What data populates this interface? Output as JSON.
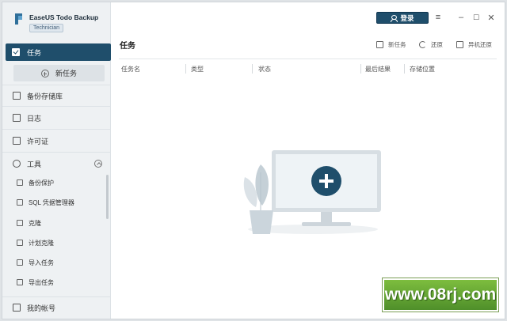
{
  "app": {
    "name": "EaseUS Todo Backup",
    "edition": "Technician"
  },
  "topbar": {
    "login_label": "登录",
    "menu_icon": "hamburger-icon",
    "minimize_icon": "minimize-icon",
    "maximize_icon": "maximize-icon",
    "close_icon": "close-icon"
  },
  "sidebar": {
    "active_item": "任务",
    "new_task": "新任务",
    "items": [
      {
        "label": "备份存储库",
        "icon": "storage-icon"
      },
      {
        "label": "日志",
        "icon": "log-icon"
      },
      {
        "label": "许可证",
        "icon": "license-icon"
      },
      {
        "label": "工具",
        "icon": "tools-icon"
      }
    ],
    "tools_sub": [
      {
        "label": "备份保护",
        "icon": "protect-icon"
      },
      {
        "label": "SQL 凭据管理器",
        "icon": "sql-icon"
      },
      {
        "label": "克隆",
        "icon": "clone-icon"
      },
      {
        "label": "计划克隆",
        "icon": "schedule-clone-icon"
      },
      {
        "label": "导入任务",
        "icon": "import-icon"
      },
      {
        "label": "导出任务",
        "icon": "export-icon"
      }
    ],
    "account": "我的帐号"
  },
  "main": {
    "title": "任务",
    "actions": [
      {
        "label": "新任务",
        "icon": "add-task-icon"
      },
      {
        "label": "还原",
        "icon": "restore-icon"
      },
      {
        "label": "异机还原",
        "icon": "universal-restore-icon"
      }
    ],
    "columns": [
      "任务名",
      "类型",
      "状态",
      "最后结果",
      "存储位置"
    ]
  },
  "watermark": "www.08rj.com",
  "colors": {
    "accent": "#1f4e6b",
    "sidebar_bg": "#eef1f3"
  }
}
